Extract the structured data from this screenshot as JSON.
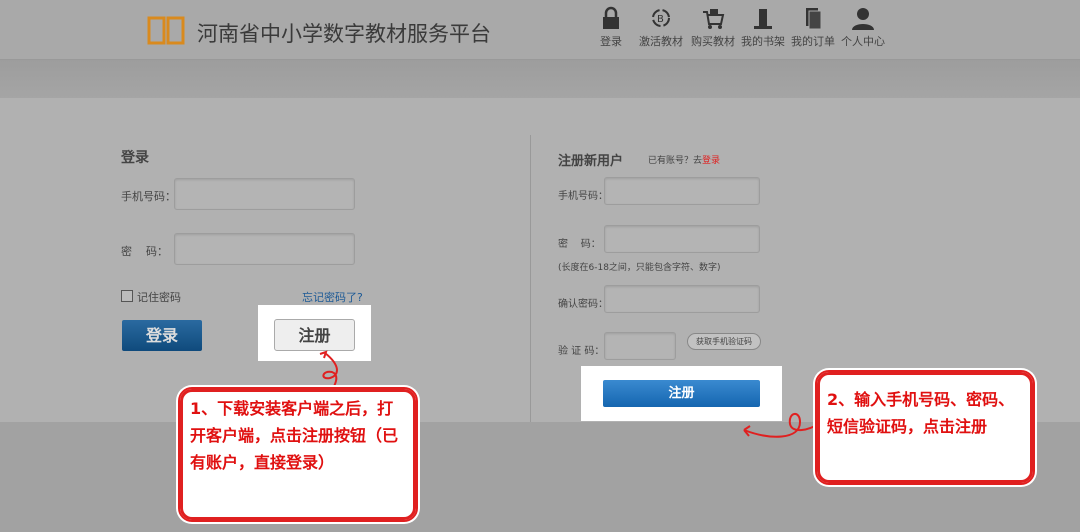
{
  "header": {
    "title": "河南省中小学数字教材服务平台",
    "nav": [
      {
        "label": "登录",
        "icon": "lock-icon"
      },
      {
        "label": "激活教材",
        "icon": "activate-icon"
      },
      {
        "label": "购买教材",
        "icon": "cart-icon"
      },
      {
        "label": "我的书架",
        "icon": "bookshelf-icon"
      },
      {
        "label": "我的订单",
        "icon": "order-icon"
      },
      {
        "label": "个人中心",
        "icon": "user-icon"
      }
    ]
  },
  "login": {
    "title": "登录",
    "phone_label": "手机号码：",
    "password_label": "密    码：",
    "remember": "记住密码",
    "forgot": "忘记密码了?",
    "login_button": "登录",
    "register_button": "注册"
  },
  "register": {
    "title": "注册新用户",
    "has_account": "已有账号？去",
    "login_link": "登录",
    "phone_label": "手机号码：",
    "password_label": "密    码：",
    "password_hint": "(长度在6-18之间，只能包含字符、数字)",
    "confirm_label": "确认密码：",
    "code_label": "验 证 码：",
    "get_code_button": "获取手机验证码",
    "register_button": "注册"
  },
  "notes": {
    "note1": "1、下载安装客户端之后，打开客户端，点击注册按钮（已有账户，直接登录）",
    "note2": "2、输入手机号码、密码、短信验证码，点击注册"
  },
  "colors": {
    "accent": "#0f5a94",
    "annotation": "#e01010",
    "logo": "#d98a1e"
  }
}
